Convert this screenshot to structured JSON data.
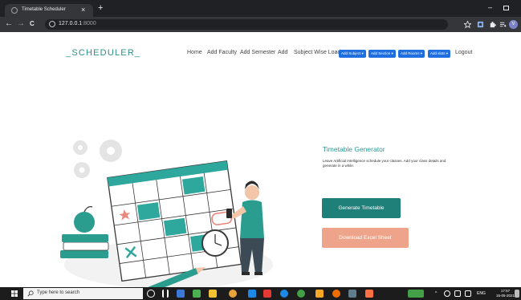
{
  "browser": {
    "tab_title": "Timetable Scheduler",
    "tab_close": "×",
    "new_tab": "+",
    "url_host": "127.0.0.1",
    "url_port": ":8000",
    "nav_back": "←",
    "nav_forward": "→",
    "nav_reload": "C",
    "minimize": "–",
    "profile_initial": "V"
  },
  "page": {
    "brand": "_SCHEDULER_",
    "nav": {
      "home": "Home",
      "add_faculty": "Add Faculty",
      "add_semester": "Add Semester",
      "add": "Add",
      "subject_wise_load": "Subject Wise Load",
      "add_subject": "Add Subject ▾",
      "add_section": "Add Section ▾",
      "add_rooms": "Add Rooms ▾",
      "add_slots": "Add slots ▾",
      "logout": "Logout"
    },
    "hero": {
      "title": "Timetable Generator",
      "description": "Leave Artificial Intelligence schedule your classes. Add your class details and generate in a while.",
      "generate_button": "Generate Timetable",
      "excel_button": "Download Excel Sheet"
    }
  },
  "taskbar": {
    "search_placeholder": "Type here to search",
    "language": "ENG",
    "time": "17:57",
    "date": "15-05-2021"
  },
  "colors": {
    "brand_teal": "#2e9088",
    "generate_button": "#1f7f79",
    "excel_button": "#eda48b",
    "nav_dropdown": "#1f6fe0"
  }
}
